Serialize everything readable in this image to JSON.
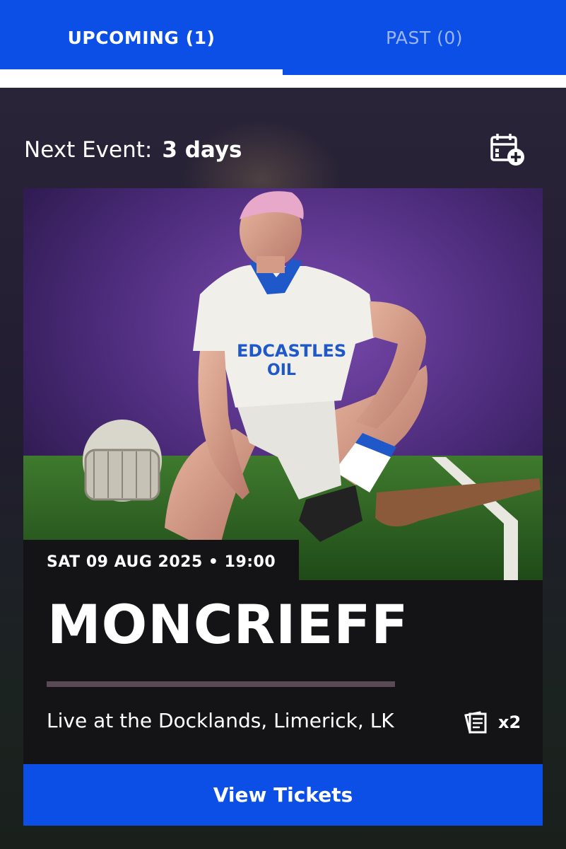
{
  "tabs": {
    "upcoming_label": "UPCOMING (1)",
    "past_label": "PAST (0)",
    "active": "upcoming"
  },
  "next_event": {
    "label": "Next Event:",
    "value": "3 days"
  },
  "icons": {
    "add_to_calendar": "calendar-plus-icon",
    "tickets": "ticket-stack-icon"
  },
  "event": {
    "datetime": "SAT 09 AUG 2025 • 19:00",
    "title": "MONCRIEFF",
    "venue": "Live at the Docklands, Limerick, LK",
    "ticket_count": "x2",
    "cta_label": "View Tickets"
  },
  "colors": {
    "brand_blue": "#0b4fe6",
    "card_background": "#141316",
    "text": "#ffffff"
  }
}
